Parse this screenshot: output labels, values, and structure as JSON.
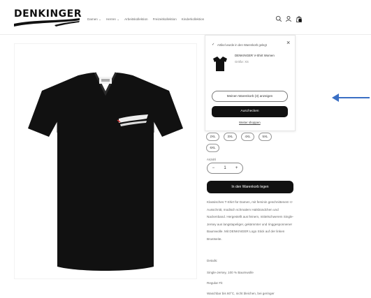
{
  "header": {
    "logo_text": "DENKINGER",
    "nav": [
      "Damen ⌄",
      "Herren ⌄",
      "Arbeitskollektion",
      "Freizeitkollektion",
      "Kinderkollektion"
    ],
    "icons": [
      "search-icon",
      "user-icon",
      "cart-icon"
    ]
  },
  "popup": {
    "confirm_message": "Artikel wurde in den Warenkorb gelegt",
    "product_name": "DENKINGER V-Shirt Women",
    "product_size": "Größe: XS",
    "view_cart_label": "Meinen Warenkorb (3) anzeigen",
    "checkout_label": "Auschecken",
    "continue_label": "Weiter shoppen"
  },
  "product": {
    "sizes_row1": [
      "2XL",
      "3XL",
      "4XL",
      "5XL"
    ],
    "sizes_row2": [
      "6XL"
    ],
    "quantity_label": "Anzahl",
    "quantity_value": "1",
    "add_to_cart_label": "In den Warenkorb legen",
    "description": "Klassisches T-Shirt für Damen, mit feminin geschnittenem V-Ausschnitt, modisch schmalem Halsbündchen und Nackenband. Hergestellt aus feinem, mittelschwerem Single-Jersey aus langstapeliger, gekämmter und ringgesponnener Baumwolle. Mit DENKINGER Logo Stick auf der linken Brustseite.",
    "details_label": "Details:",
    "material": "Single-Jersey, 100 % Baumwolle",
    "fit": "Regular Fit",
    "care": "Waschbar bis 60°C, nicht bleichen, bei geringer"
  },
  "colors": {
    "arrow": "#3a6fc4",
    "button_dark": "#111111"
  }
}
